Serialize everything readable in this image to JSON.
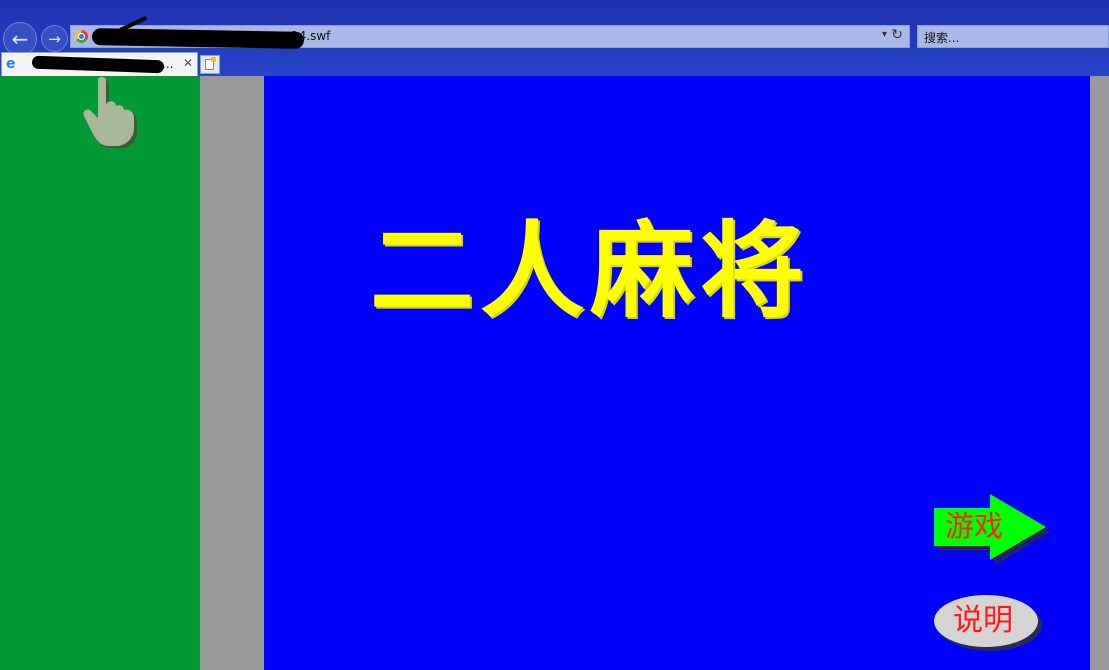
{
  "browser": {
    "back_glyph": "←",
    "forward_glyph": "→",
    "address_url": "14.swf",
    "address_dropdown_glyph": "▾",
    "refresh_glyph": "↻",
    "search_placeholder": "搜索...",
    "tab_title": "...",
    "tab_close_glyph": "✕",
    "tab_icon_glyph": "e"
  },
  "game": {
    "title": "二人麻将",
    "play_label": "游戏",
    "help_label": "说明"
  },
  "icons": {
    "back": "back-arrow-icon",
    "forward": "forward-arrow-icon",
    "favicon": "chrome-logo-icon",
    "refresh": "refresh-icon",
    "ie": "ie-logo-icon",
    "new_tab": "new-tab-icon",
    "cursor": "hand-pointer-icon"
  },
  "colors": {
    "chrome_bg": "#2038b8",
    "left_panel": "#009933",
    "stage_bg": "#0000ff",
    "side_gray": "#999999",
    "title": "#ffff00",
    "play_arrow": "#00ff00",
    "button_text": "#ff2222",
    "help_oval": "#d4d4d4"
  }
}
